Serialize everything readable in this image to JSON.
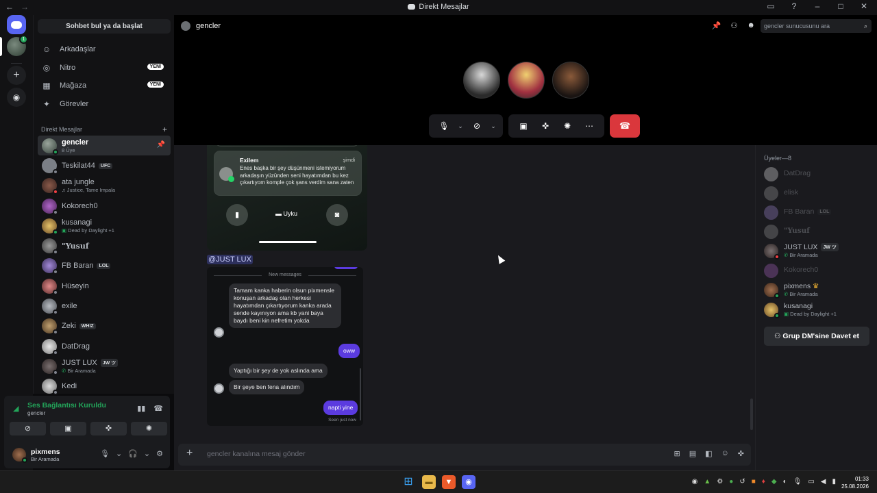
{
  "window": {
    "title": "Direkt Mesajlar"
  },
  "sidebar": {
    "search": "Sohbet bul ya da başlat",
    "nav": [
      {
        "label": "Arkadaşlar",
        "icon": "friends-icon",
        "badge": ""
      },
      {
        "label": "Nitro",
        "icon": "nitro-icon",
        "badge": "YENİ"
      },
      {
        "label": "Mağaza",
        "icon": "shop-icon",
        "badge": "YENİ"
      },
      {
        "label": "Görevler",
        "icon": "quests-icon",
        "badge": ""
      }
    ],
    "dm_header": "Direkt Mesajlar",
    "dms": [
      {
        "name": "gencler",
        "sub": "8 Üye",
        "tag": "",
        "status": "group"
      },
      {
        "name": "Teskilat44",
        "sub": "",
        "tag": "UFC",
        "status": "offline"
      },
      {
        "name": "ata jungle",
        "sub": "Justice, Tame Impala",
        "tag": "",
        "status": "dnd"
      },
      {
        "name": "Kokorech0",
        "sub": "",
        "tag": "",
        "status": "offline"
      },
      {
        "name": "kusanagi",
        "sub": "Dead by Daylight +1",
        "tag": "",
        "status": "online"
      },
      {
        "name": "\"Yusuf",
        "sub": "",
        "tag": "",
        "status": "offline"
      },
      {
        "name": "FB Baran",
        "sub": "",
        "tag": "LOL",
        "status": "offline"
      },
      {
        "name": "Hüseyin",
        "sub": "",
        "tag": "",
        "status": "offline"
      },
      {
        "name": "exile",
        "sub": "",
        "tag": "",
        "status": "offline"
      },
      {
        "name": "Zeki",
        "sub": "",
        "tag": "WHIZ",
        "status": "offline"
      },
      {
        "name": "DatDrag",
        "sub": "",
        "tag": "",
        "status": "offline"
      },
      {
        "name": "JUST LUX",
        "sub": "Bir Aramada",
        "tag": "JW ツ",
        "status": "offline"
      },
      {
        "name": "Kedi",
        "sub": "",
        "tag": "",
        "status": "offline"
      }
    ]
  },
  "voice": {
    "status": "Ses Bağlantısı Kuruldu",
    "channel": "gencler"
  },
  "user": {
    "name": "pixmens",
    "status": "Bir Aramada"
  },
  "call": {
    "channel": "gencler",
    "search_placeholder": "gencler sunucusunu ara"
  },
  "chat": {
    "notification": {
      "from": "Exilem",
      "when": "şimdi",
      "message": "Enes başka bir şey düşünmeni istemiyorum arkadaşın yüzünden seni hayatımdan bu kez çıkartıyom komple çok şans verdim sana zaten"
    },
    "lock_center": "Uyku",
    "mention": "@JUST LUX",
    "new_messages": "New messages",
    "messages": [
      "Tamam kanka haberin olsun pixmensle konuşan arkadaş olan herkesi hayatımdan çıkartıyorum kanka arada sende kayınıyon ama kb yani baya baydı beni kin nefretim yokda",
      "oww",
      "Yaptığı bir şey de yok aslında ama",
      "Bir şeye ben fena alındım",
      "napti yine"
    ],
    "seen": "Seen just now",
    "composer_placeholder": "gencler kanalına mesaj gönder"
  },
  "members": {
    "header": "Üyeler—8",
    "list": [
      {
        "name": "DatDrag",
        "sub": "",
        "tag": "",
        "online": false
      },
      {
        "name": "elisk",
        "sub": "",
        "tag": "",
        "online": false
      },
      {
        "name": "FB Baran",
        "sub": "",
        "tag": "LOL",
        "online": false
      },
      {
        "name": "\"Yusuf",
        "sub": "",
        "tag": "",
        "online": false
      },
      {
        "name": "JUST LUX",
        "sub": "Bir Aramada",
        "tag": "JW ツ",
        "online": true
      },
      {
        "name": "Kokorech0",
        "sub": "",
        "tag": "",
        "online": false
      },
      {
        "name": "pixmens",
        "sub": "Bir Aramada",
        "tag": "",
        "online": true
      },
      {
        "name": "kusanagi",
        "sub": "Dead by Daylight +1",
        "tag": "",
        "online": true
      }
    ],
    "invite": "Grup DM'sine Davet et"
  },
  "taskbar": {
    "time": "01:33",
    "date": "25.08.2026"
  },
  "colors": {
    "accent": "#5865f2",
    "online": "#23a55a",
    "hangup": "#da373c",
    "bubble_me": "#5b3bdf"
  }
}
